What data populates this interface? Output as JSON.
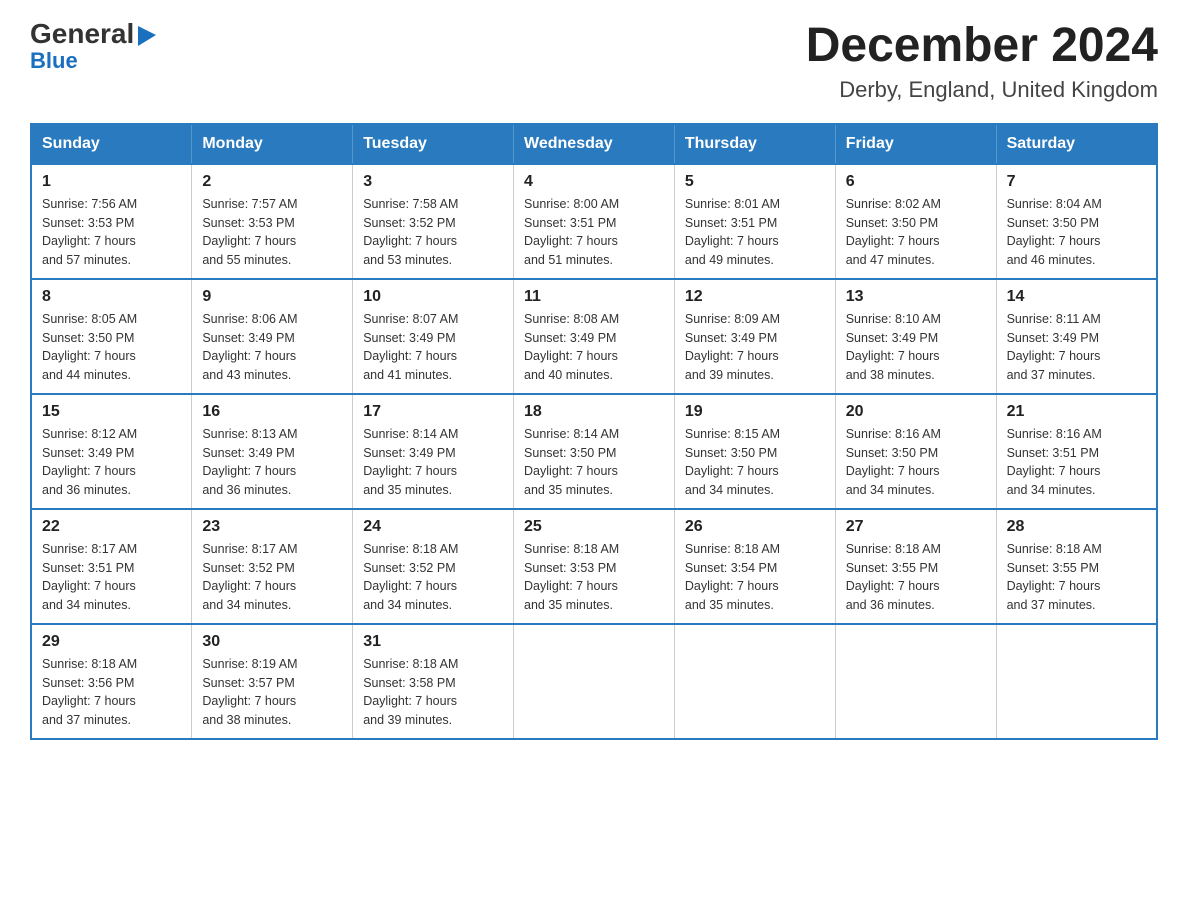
{
  "logo": {
    "general": "General",
    "blue": "Blue",
    "triangle": "▶"
  },
  "title": {
    "month_year": "December 2024",
    "location": "Derby, England, United Kingdom"
  },
  "header_days": [
    "Sunday",
    "Monday",
    "Tuesday",
    "Wednesday",
    "Thursday",
    "Friday",
    "Saturday"
  ],
  "weeks": [
    [
      {
        "day": "1",
        "info": "Sunrise: 7:56 AM\nSunset: 3:53 PM\nDaylight: 7 hours\nand 57 minutes."
      },
      {
        "day": "2",
        "info": "Sunrise: 7:57 AM\nSunset: 3:53 PM\nDaylight: 7 hours\nand 55 minutes."
      },
      {
        "day": "3",
        "info": "Sunrise: 7:58 AM\nSunset: 3:52 PM\nDaylight: 7 hours\nand 53 minutes."
      },
      {
        "day": "4",
        "info": "Sunrise: 8:00 AM\nSunset: 3:51 PM\nDaylight: 7 hours\nand 51 minutes."
      },
      {
        "day": "5",
        "info": "Sunrise: 8:01 AM\nSunset: 3:51 PM\nDaylight: 7 hours\nand 49 minutes."
      },
      {
        "day": "6",
        "info": "Sunrise: 8:02 AM\nSunset: 3:50 PM\nDaylight: 7 hours\nand 47 minutes."
      },
      {
        "day": "7",
        "info": "Sunrise: 8:04 AM\nSunset: 3:50 PM\nDaylight: 7 hours\nand 46 minutes."
      }
    ],
    [
      {
        "day": "8",
        "info": "Sunrise: 8:05 AM\nSunset: 3:50 PM\nDaylight: 7 hours\nand 44 minutes."
      },
      {
        "day": "9",
        "info": "Sunrise: 8:06 AM\nSunset: 3:49 PM\nDaylight: 7 hours\nand 43 minutes."
      },
      {
        "day": "10",
        "info": "Sunrise: 8:07 AM\nSunset: 3:49 PM\nDaylight: 7 hours\nand 41 minutes."
      },
      {
        "day": "11",
        "info": "Sunrise: 8:08 AM\nSunset: 3:49 PM\nDaylight: 7 hours\nand 40 minutes."
      },
      {
        "day": "12",
        "info": "Sunrise: 8:09 AM\nSunset: 3:49 PM\nDaylight: 7 hours\nand 39 minutes."
      },
      {
        "day": "13",
        "info": "Sunrise: 8:10 AM\nSunset: 3:49 PM\nDaylight: 7 hours\nand 38 minutes."
      },
      {
        "day": "14",
        "info": "Sunrise: 8:11 AM\nSunset: 3:49 PM\nDaylight: 7 hours\nand 37 minutes."
      }
    ],
    [
      {
        "day": "15",
        "info": "Sunrise: 8:12 AM\nSunset: 3:49 PM\nDaylight: 7 hours\nand 36 minutes."
      },
      {
        "day": "16",
        "info": "Sunrise: 8:13 AM\nSunset: 3:49 PM\nDaylight: 7 hours\nand 36 minutes."
      },
      {
        "day": "17",
        "info": "Sunrise: 8:14 AM\nSunset: 3:49 PM\nDaylight: 7 hours\nand 35 minutes."
      },
      {
        "day": "18",
        "info": "Sunrise: 8:14 AM\nSunset: 3:50 PM\nDaylight: 7 hours\nand 35 minutes."
      },
      {
        "day": "19",
        "info": "Sunrise: 8:15 AM\nSunset: 3:50 PM\nDaylight: 7 hours\nand 34 minutes."
      },
      {
        "day": "20",
        "info": "Sunrise: 8:16 AM\nSunset: 3:50 PM\nDaylight: 7 hours\nand 34 minutes."
      },
      {
        "day": "21",
        "info": "Sunrise: 8:16 AM\nSunset: 3:51 PM\nDaylight: 7 hours\nand 34 minutes."
      }
    ],
    [
      {
        "day": "22",
        "info": "Sunrise: 8:17 AM\nSunset: 3:51 PM\nDaylight: 7 hours\nand 34 minutes."
      },
      {
        "day": "23",
        "info": "Sunrise: 8:17 AM\nSunset: 3:52 PM\nDaylight: 7 hours\nand 34 minutes."
      },
      {
        "day": "24",
        "info": "Sunrise: 8:18 AM\nSunset: 3:52 PM\nDaylight: 7 hours\nand 34 minutes."
      },
      {
        "day": "25",
        "info": "Sunrise: 8:18 AM\nSunset: 3:53 PM\nDaylight: 7 hours\nand 35 minutes."
      },
      {
        "day": "26",
        "info": "Sunrise: 8:18 AM\nSunset: 3:54 PM\nDaylight: 7 hours\nand 35 minutes."
      },
      {
        "day": "27",
        "info": "Sunrise: 8:18 AM\nSunset: 3:55 PM\nDaylight: 7 hours\nand 36 minutes."
      },
      {
        "day": "28",
        "info": "Sunrise: 8:18 AM\nSunset: 3:55 PM\nDaylight: 7 hours\nand 37 minutes."
      }
    ],
    [
      {
        "day": "29",
        "info": "Sunrise: 8:18 AM\nSunset: 3:56 PM\nDaylight: 7 hours\nand 37 minutes."
      },
      {
        "day": "30",
        "info": "Sunrise: 8:19 AM\nSunset: 3:57 PM\nDaylight: 7 hours\nand 38 minutes."
      },
      {
        "day": "31",
        "info": "Sunrise: 8:18 AM\nSunset: 3:58 PM\nDaylight: 7 hours\nand 39 minutes."
      },
      null,
      null,
      null,
      null
    ]
  ]
}
